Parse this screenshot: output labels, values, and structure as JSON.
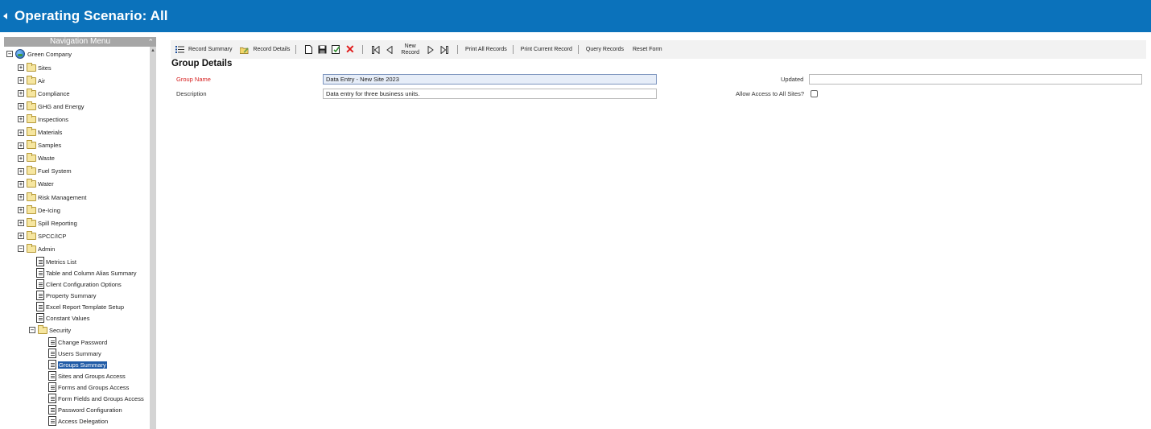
{
  "header": {
    "title": "Operating Scenario: All"
  },
  "nav": {
    "title": "Navigation Menu",
    "root": "Green Company",
    "folders": [
      "Sites",
      "Air",
      "Compliance",
      "GHG and Energy",
      "Inspections",
      "Materials",
      "Samples",
      "Waste",
      "Fuel System",
      "Water",
      "Risk Management",
      "De-Icing",
      "Spill Reporting",
      "SPCC/ICP",
      "Admin"
    ],
    "admin_items": [
      "Metrics List",
      "Table and Column Alias Summary",
      "Client Configuration Options",
      "Property Summary",
      "Excel Report Template Setup",
      "Constant Values"
    ],
    "security_label": "Security",
    "security_items": [
      "Change Password",
      "Users Summary",
      "Groups Summary",
      "Sites and Groups Access",
      "Forms and Groups Access",
      "Form Fields and Groups Access",
      "Password Configuration",
      "Access Delegation"
    ]
  },
  "toolbar": {
    "record_summary": "Record Summary",
    "record_details": "Record Details",
    "new_record_line1": "New",
    "new_record_line2": "Record",
    "print_all": "Print All Records",
    "print_current": "Print Current Record",
    "query": "Query Records",
    "reset": "Reset Form"
  },
  "form": {
    "section_title": "Group Details",
    "group_name_label": "Group Name",
    "group_name_value": "Data Entry - New Site 2023",
    "description_label": "Description",
    "description_value": "Data entry for three business units.",
    "updated_label": "Updated",
    "updated_value": "",
    "allow_access_label": "Allow Access to All Sites?"
  }
}
